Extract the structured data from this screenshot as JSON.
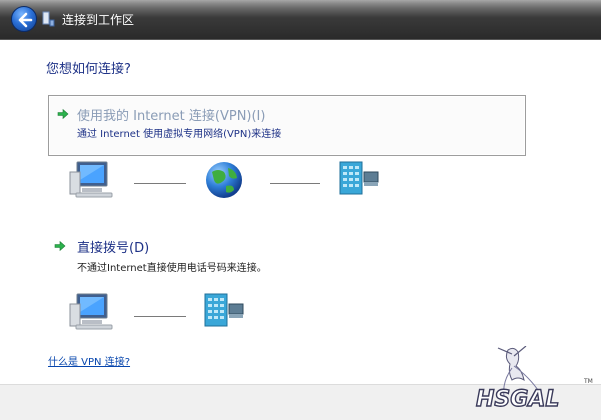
{
  "window": {
    "title": "连接到工作区"
  },
  "main": {
    "question": "您想如何连接?",
    "options": [
      {
        "title": "使用我的 Internet 连接(VPN)(I)",
        "description": "通过 Internet 使用虚拟专用网络(VPN)来连接"
      },
      {
        "title": "直接拨号(D)",
        "description": "不通过Internet直接使用电话号码来连接。"
      }
    ],
    "help_link": "什么是 VPN 连接?"
  },
  "watermark": {
    "text": "HSGAL",
    "tm": "TM"
  },
  "colors": {
    "accent": "#1e3287",
    "link": "#0645ad",
    "disabled_title": "#8a9cb6",
    "arrow_green": "#2bb24c"
  }
}
